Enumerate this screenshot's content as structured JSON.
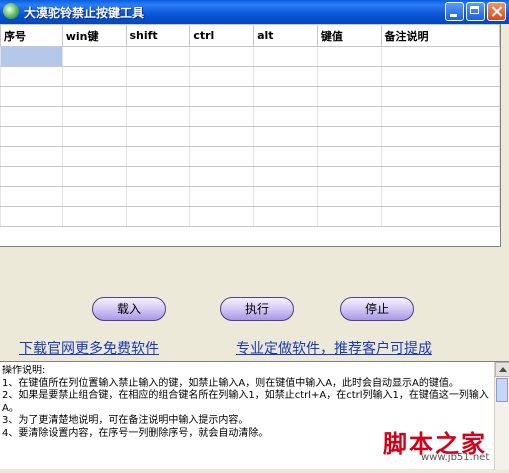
{
  "window": {
    "title": "大漠驼铃禁止按键工具"
  },
  "grid": {
    "columns": [
      "序号",
      "win键",
      "shift",
      "ctrl",
      "alt",
      "键值",
      "备注说明"
    ],
    "rows": 9
  },
  "buttons": {
    "load": "载入",
    "execute": "执行",
    "stop": "停止"
  },
  "links": {
    "download": "下载官网更多免费软件",
    "custom": "专业定做软件，推荐客户可提成"
  },
  "instructions": "操作说明:\n1、在键值所在列位置输入禁止输入的键，如禁止输入A，则在键值中输入A，此时会自动显示A的键值。\n2、如果是要禁止组合键，在相应的组合键名所在列输入1，如禁止ctrl+A，在ctrl列输入1，在键值这一列输入A。\n3、为了更清楚地说明，可在备注说明中输入提示内容。\n4、要清除设置内容，在序号一列删除序号，就会自动清除。",
  "watermark": {
    "big": "脚本之家",
    "small": "www.jb51.net"
  },
  "colors": {
    "titlebar": "#0a55d6",
    "link": "#1a39b8",
    "selected_cell": "#b4c8ec",
    "button": "#a797e6",
    "watermark": "#d0021b"
  }
}
